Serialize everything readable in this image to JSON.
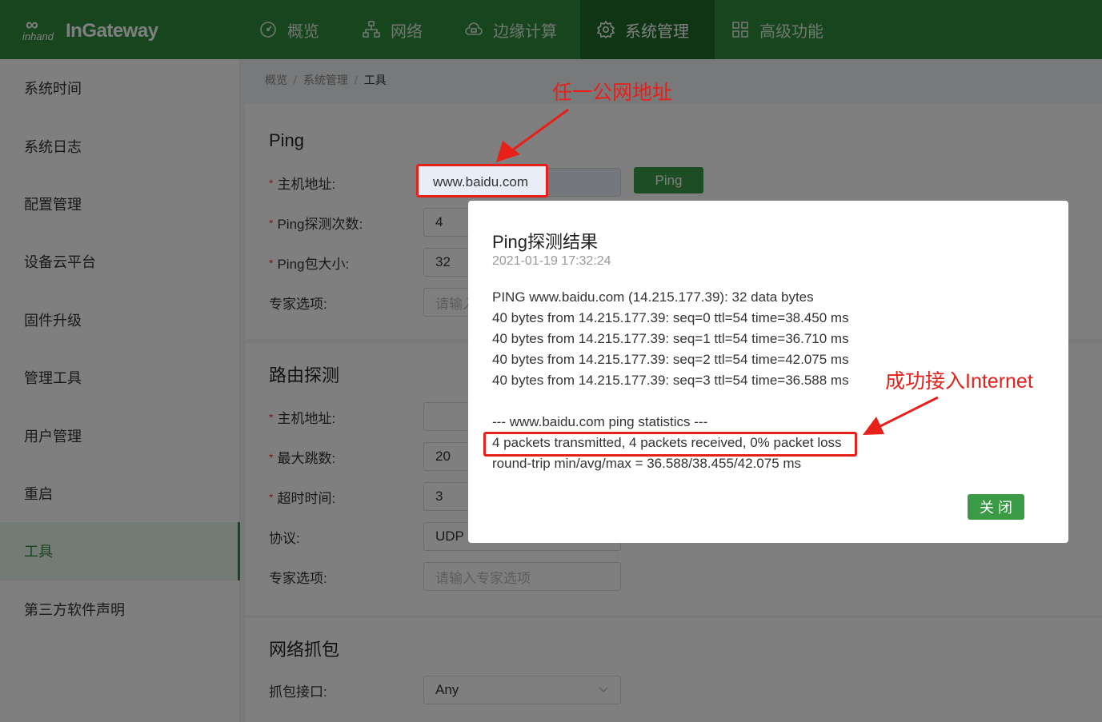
{
  "header": {
    "logo_brand": "inhand",
    "logo_name": "InGateway",
    "nav": [
      {
        "label": "概览",
        "icon": "dashboard-icon"
      },
      {
        "label": "网络",
        "icon": "network-icon"
      },
      {
        "label": "边缘计算",
        "icon": "cloud-icon"
      },
      {
        "label": "系统管理",
        "icon": "gear-icon",
        "active": true
      },
      {
        "label": "高级功能",
        "icon": "grid-icon"
      }
    ]
  },
  "sidebar": {
    "items": [
      {
        "label": "系统时间"
      },
      {
        "label": "系统日志"
      },
      {
        "label": "配置管理"
      },
      {
        "label": "设备云平台"
      },
      {
        "label": "固件升级"
      },
      {
        "label": "管理工具"
      },
      {
        "label": "用户管理"
      },
      {
        "label": "重启"
      },
      {
        "label": "工具",
        "active": true
      },
      {
        "label": "第三方软件声明"
      }
    ]
  },
  "breadcrumb": {
    "items": [
      "概览",
      "系统管理",
      "工具"
    ],
    "separator": "/"
  },
  "ping": {
    "title": "Ping",
    "host_label": "主机地址:",
    "host_value": "www.baidu.com",
    "count_label": "Ping探测次数:",
    "count_value": "4",
    "size_label": "Ping包大小:",
    "size_value": "32",
    "expert_label": "专家选项:",
    "expert_placeholder": "请输入",
    "button": "Ping"
  },
  "traceroute": {
    "title": "路由探测",
    "host_label": "主机地址:",
    "hops_label": "最大跳数:",
    "hops_value": "20",
    "timeout_label": "超时时间:",
    "timeout_value": "3",
    "protocol_label": "协议:",
    "protocol_value": "UDP",
    "expert_label": "专家选项:",
    "expert_placeholder": "请输入专家选项"
  },
  "capture": {
    "title": "网络抓包",
    "iface_label": "抓包接口:",
    "iface_value": "Any"
  },
  "modal": {
    "title": "Ping探测结果",
    "time": "2021-01-19 17:32:24",
    "lines": [
      "PING www.baidu.com (14.215.177.39): 32 data bytes",
      "40 bytes from 14.215.177.39: seq=0 ttl=54 time=38.450 ms",
      "40 bytes from 14.215.177.39: seq=1 ttl=54 time=36.710 ms",
      "40 bytes from 14.215.177.39: seq=2 ttl=54 time=42.075 ms",
      "40 bytes from 14.215.177.39: seq=3 ttl=54 time=36.588 ms",
      "",
      "--- www.baidu.com ping statistics ---",
      "4 packets transmitted, 4 packets received, 0% packet loss",
      "round-trip min/avg/max = 36.588/38.455/42.075 ms"
    ],
    "close_button": "关 闭"
  },
  "annotations": {
    "top_note": "任一公网地址",
    "right_note": "成功接入Internet",
    "color": "#e8201a"
  },
  "colors": {
    "brand": "#2e8b3a",
    "nav_active": "#1f6b2a",
    "button": "#3a9a45"
  }
}
